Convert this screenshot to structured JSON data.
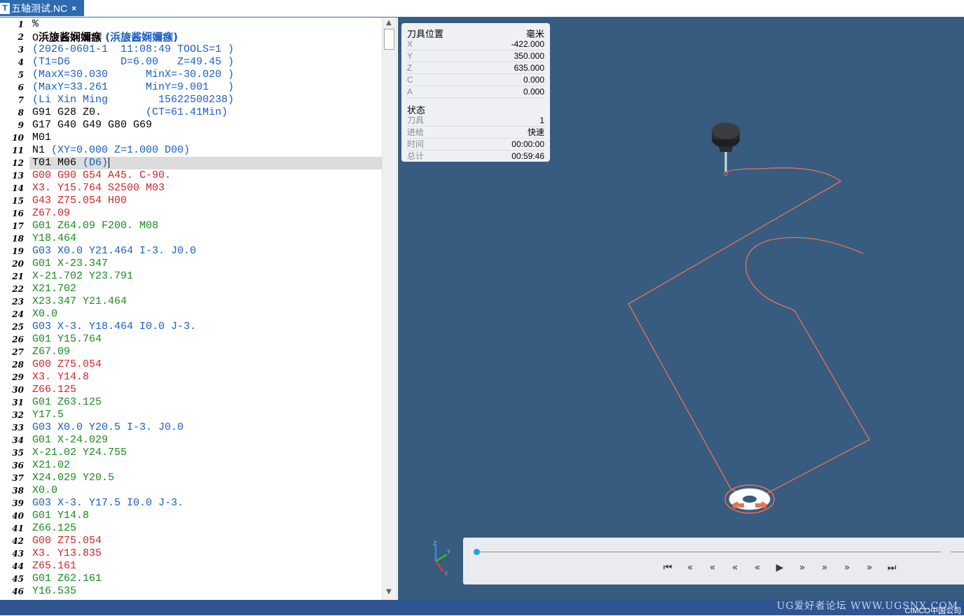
{
  "tab": {
    "icon": "nc-file-icon",
    "title": "五轴测试.NC",
    "close": "×"
  },
  "editor": {
    "current_line": 12,
    "lines": [
      {
        "n": "1",
        "parts": [
          {
            "c": "k",
            "t": "%"
          }
        ]
      },
      {
        "n": "2",
        "parts": [
          {
            "c": "k",
            "t": "O"
          },
          {
            "c": "k cjk",
            "t": "浜旇酱娴嬭瘯"
          },
          {
            "c": "b cjk",
            "t": " (浜旇酱娴嬭瘯)"
          }
        ]
      },
      {
        "n": "3",
        "parts": [
          {
            "c": "b",
            "t": "(2026-0601-1  11:08:49 TOOLS=1 )"
          }
        ]
      },
      {
        "n": "4",
        "parts": [
          {
            "c": "b",
            "t": "(T1=D6        D=6.00   Z=49.45 )"
          }
        ]
      },
      {
        "n": "5",
        "parts": [
          {
            "c": "b",
            "t": "(MaxX=30.030      MinX=-30.020 )"
          }
        ]
      },
      {
        "n": "6",
        "parts": [
          {
            "c": "b",
            "t": "(MaxY=33.261      MinY=9.001   )"
          }
        ]
      },
      {
        "n": "7",
        "parts": [
          {
            "c": "b",
            "t": "(Li Xin Ming        15622500238)"
          }
        ]
      },
      {
        "n": "8",
        "parts": [
          {
            "c": "k",
            "t": "G91 G28 Z0.       "
          },
          {
            "c": "b",
            "t": "(CT=61.41Min)"
          }
        ]
      },
      {
        "n": "9",
        "parts": [
          {
            "c": "k",
            "t": "G17 G40 G49 G80 G69"
          }
        ]
      },
      {
        "n": "10",
        "parts": [
          {
            "c": "k",
            "t": "M01"
          }
        ]
      },
      {
        "n": "11",
        "parts": [
          {
            "c": "k",
            "t": "N1 "
          },
          {
            "c": "b",
            "t": "(XY=0.000 Z=1.000 D00)"
          }
        ]
      },
      {
        "n": "12",
        "parts": [
          {
            "c": "k",
            "t": "T01 M06 "
          },
          {
            "c": "b",
            "t": "(D6)"
          }
        ]
      },
      {
        "n": "13",
        "parts": [
          {
            "c": "r",
            "t": "G00 G90 G54 A45. C-90."
          }
        ]
      },
      {
        "n": "14",
        "parts": [
          {
            "c": "r",
            "t": "X3. Y15.764 S2500 M03"
          }
        ]
      },
      {
        "n": "15",
        "parts": [
          {
            "c": "r",
            "t": "G43 Z75.054 H00"
          }
        ]
      },
      {
        "n": "16",
        "parts": [
          {
            "c": "r",
            "t": "Z67.09"
          }
        ]
      },
      {
        "n": "17",
        "parts": [
          {
            "c": "g",
            "t": "G01 Z64.09 F200. M08"
          }
        ]
      },
      {
        "n": "18",
        "parts": [
          {
            "c": "g",
            "t": "Y18.464"
          }
        ]
      },
      {
        "n": "19",
        "parts": [
          {
            "c": "b",
            "t": "G03 X0.0 Y21.464 I-3. J0.0"
          }
        ]
      },
      {
        "n": "20",
        "parts": [
          {
            "c": "g",
            "t": "G01 X-23.347"
          }
        ]
      },
      {
        "n": "21",
        "parts": [
          {
            "c": "g",
            "t": "X-21.702 Y23.791"
          }
        ]
      },
      {
        "n": "22",
        "parts": [
          {
            "c": "g",
            "t": "X21.702"
          }
        ]
      },
      {
        "n": "23",
        "parts": [
          {
            "c": "g",
            "t": "X23.347 Y21.464"
          }
        ]
      },
      {
        "n": "24",
        "parts": [
          {
            "c": "g",
            "t": "X0.0"
          }
        ]
      },
      {
        "n": "25",
        "parts": [
          {
            "c": "b",
            "t": "G03 X-3. Y18.464 I0.0 J-3."
          }
        ]
      },
      {
        "n": "26",
        "parts": [
          {
            "c": "g",
            "t": "G01 Y15.764"
          }
        ]
      },
      {
        "n": "27",
        "parts": [
          {
            "c": "g",
            "t": "Z67.09"
          }
        ]
      },
      {
        "n": "28",
        "parts": [
          {
            "c": "r",
            "t": "G00 Z75.054"
          }
        ]
      },
      {
        "n": "29",
        "parts": [
          {
            "c": "r",
            "t": "X3. Y14.8"
          }
        ]
      },
      {
        "n": "30",
        "parts": [
          {
            "c": "r",
            "t": "Z66.125"
          }
        ]
      },
      {
        "n": "31",
        "parts": [
          {
            "c": "g",
            "t": "G01 Z63.125"
          }
        ]
      },
      {
        "n": "32",
        "parts": [
          {
            "c": "g",
            "t": "Y17.5"
          }
        ]
      },
      {
        "n": "33",
        "parts": [
          {
            "c": "b",
            "t": "G03 X0.0 Y20.5 I-3. J0.0"
          }
        ]
      },
      {
        "n": "34",
        "parts": [
          {
            "c": "g",
            "t": "G01 X-24.029"
          }
        ]
      },
      {
        "n": "35",
        "parts": [
          {
            "c": "g",
            "t": "X-21.02 Y24.755"
          }
        ]
      },
      {
        "n": "36",
        "parts": [
          {
            "c": "g",
            "t": "X21.02"
          }
        ]
      },
      {
        "n": "37",
        "parts": [
          {
            "c": "g",
            "t": "X24.029 Y20.5"
          }
        ]
      },
      {
        "n": "38",
        "parts": [
          {
            "c": "g",
            "t": "X0.0"
          }
        ]
      },
      {
        "n": "39",
        "parts": [
          {
            "c": "b",
            "t": "G03 X-3. Y17.5 I0.0 J-3."
          }
        ]
      },
      {
        "n": "40",
        "parts": [
          {
            "c": "g",
            "t": "G01 Y14.8"
          }
        ]
      },
      {
        "n": "41",
        "parts": [
          {
            "c": "g",
            "t": "Z66.125"
          }
        ]
      },
      {
        "n": "42",
        "parts": [
          {
            "c": "r",
            "t": "G00 Z75.054"
          }
        ]
      },
      {
        "n": "43",
        "parts": [
          {
            "c": "r",
            "t": "X3. Y13.835"
          }
        ]
      },
      {
        "n": "44",
        "parts": [
          {
            "c": "r",
            "t": "Z65.161"
          }
        ]
      },
      {
        "n": "45",
        "parts": [
          {
            "c": "g",
            "t": "G01 Z62.161"
          }
        ]
      },
      {
        "n": "46",
        "parts": [
          {
            "c": "g",
            "t": "Y16.535"
          }
        ]
      }
    ],
    "colors": {
      "rapid": "#d0262a",
      "feed": "#198a1e",
      "arc_comment": "#1a5fbf"
    }
  },
  "tool_position": {
    "title": "刀具位置",
    "unit": "毫米",
    "rows": [
      {
        "label": "X",
        "value": "-422.000"
      },
      {
        "label": "Y",
        "value": "350.000"
      },
      {
        "label": "Z",
        "value": "635.000"
      },
      {
        "label": "C",
        "value": "0.000"
      },
      {
        "label": "A",
        "value": "0.000"
      }
    ]
  },
  "status": {
    "title": "状态",
    "rows": [
      {
        "label": "刀具",
        "value": "1"
      },
      {
        "label": "进给",
        "value": "快速"
      },
      {
        "label": "时间",
        "value": "00:00:00"
      },
      {
        "label": "总计",
        "value": "00:59:46"
      }
    ]
  },
  "playback": {
    "progress": 0.0,
    "buttons": [
      "skip-to-start",
      "step-back-z",
      "step-back-tool",
      "step-back-zlevel",
      "step-back-point",
      "play",
      "step-forward-point",
      "step-forward-z",
      "step-forward-tool",
      "step-forward-end",
      "skip-to-end"
    ]
  },
  "triad": {
    "x": "X",
    "y": "Y",
    "z": "Z"
  },
  "viewport": {
    "background": "#385b80",
    "toolpath_color": "#e8734f"
  },
  "footer": {
    "watermark": "UG爱好者论坛 WWW.UGSNX.COM",
    "brand": "CIMCO中国公司"
  }
}
